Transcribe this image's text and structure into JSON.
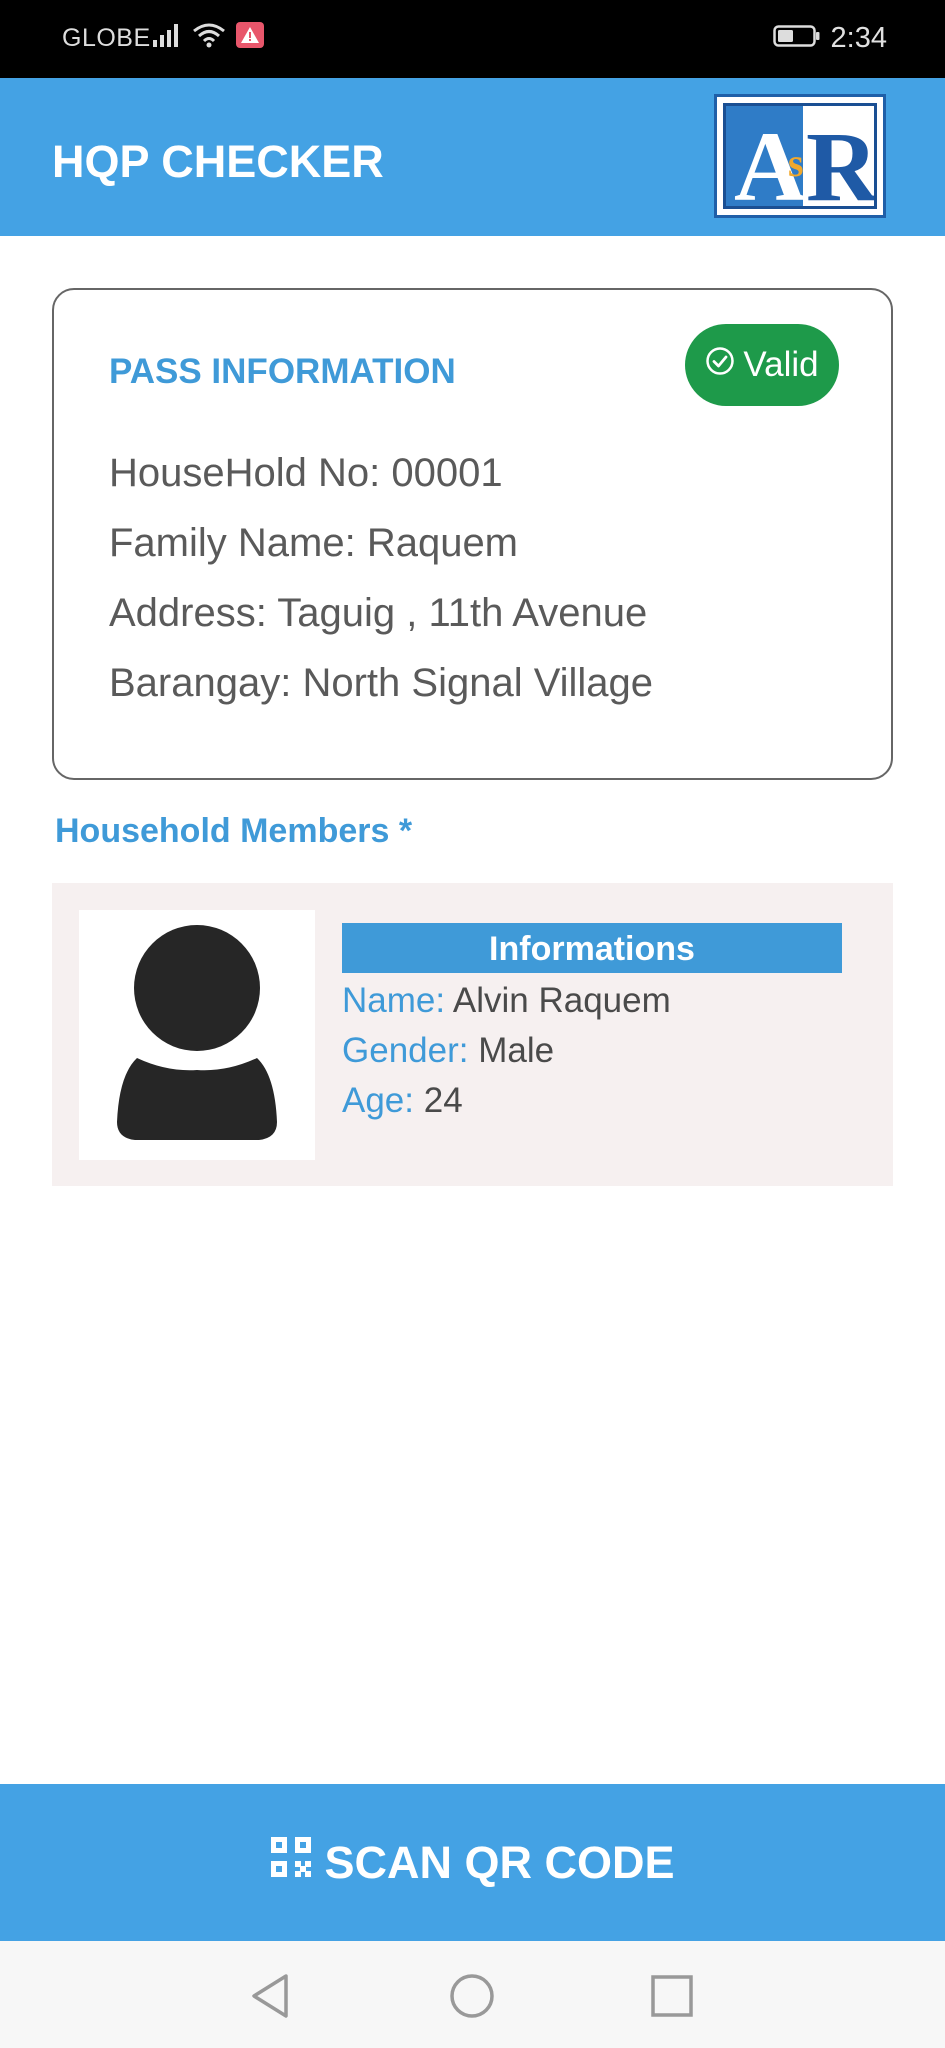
{
  "status_bar": {
    "carrier": "GLOBE",
    "time": "2:34",
    "icons": [
      "signal-icon",
      "wifi-icon",
      "alert-icon",
      "battery-icon"
    ]
  },
  "app_bar": {
    "title": "HQP CHECKER",
    "logo_icon": "asr-logo-icon"
  },
  "pass_info": {
    "heading": "PASS INFORMATION",
    "status": "Valid",
    "status_color": "#1e9a4a",
    "lines": [
      "HouseHold No: 00001",
      "Family Name: Raquem",
      "Address: Taguig , 11th Avenue",
      "Barangay: North Signal Village"
    ]
  },
  "members": {
    "heading": "Household Members *",
    "items": [
      {
        "info_header": "Informations",
        "name_label": "Name:",
        "name": "Alvin Raquem",
        "gender_label": "Gender:",
        "gender": "Male",
        "age_label": "Age:",
        "age": "24"
      }
    ]
  },
  "scan_button": {
    "label": "SCAN QR CODE",
    "icon": "qr-code-icon"
  },
  "nav_bar": {
    "icons": [
      "back-icon",
      "home-icon",
      "recents-icon"
    ]
  },
  "colors": {
    "primary": "#44a2e4",
    "accent_text": "#3f9ad8",
    "valid_green": "#1e9a4a",
    "member_bg": "#f6f0f0"
  }
}
